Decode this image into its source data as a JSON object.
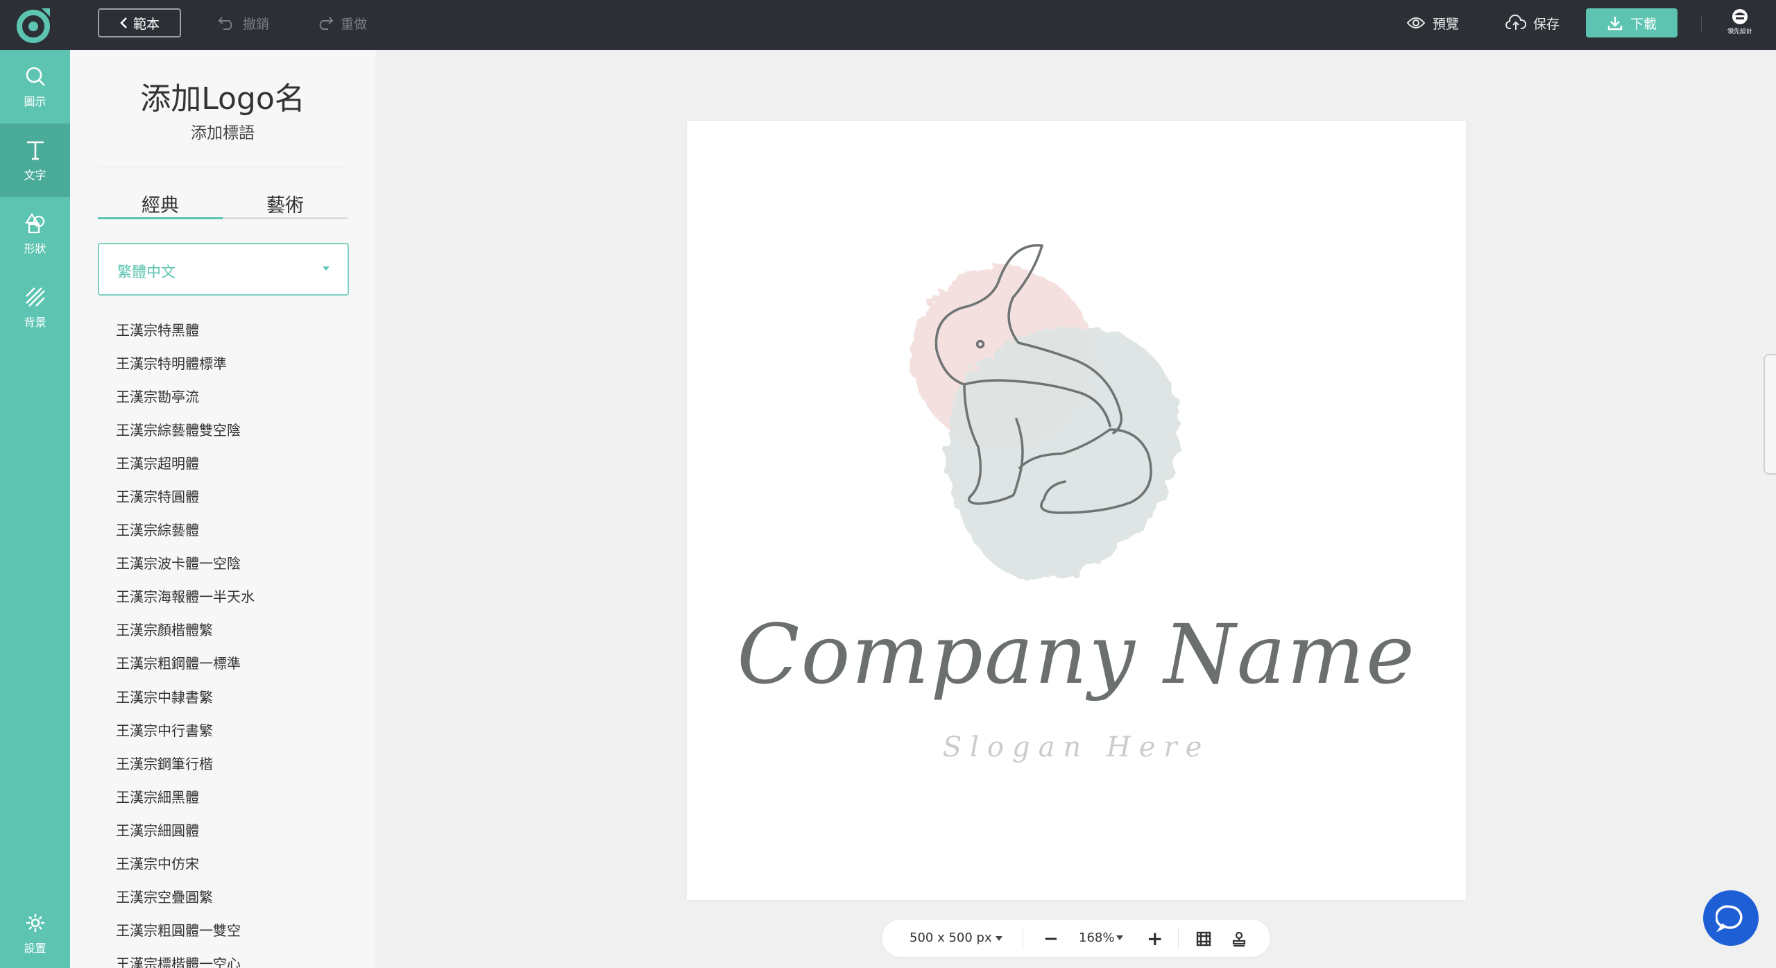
{
  "topbar": {
    "back_label": "範本",
    "undo_label": "撤銷",
    "redo_label": "重做",
    "preview_label": "預覽",
    "save_label": "保存",
    "download_label": "下載",
    "avatar_label": "領先設計"
  },
  "rail": {
    "items": [
      {
        "label": "圖示",
        "icon": "search-icon"
      },
      {
        "label": "文字",
        "icon": "text-icon"
      },
      {
        "label": "形狀",
        "icon": "shapes-icon"
      },
      {
        "label": "背景",
        "icon": "background-icon"
      }
    ],
    "settings_label": "設置"
  },
  "panel": {
    "title": "添加Logo名",
    "subtitle": "添加標語",
    "tabs": [
      "經典",
      "藝術"
    ],
    "language": "繁體中文",
    "fonts": [
      "王漢宗特黑體",
      "王漢宗特明體標準",
      "王漢宗勘亭流",
      "王漢宗綜藝體雙空陰",
      "王漢宗超明體",
      "王漢宗特圓體",
      "王漢宗綜藝體",
      "王漢宗波卡體一空陰",
      "王漢宗海報體一半天水",
      "王漢宗顏楷體繁",
      "王漢宗粗鋼體一標準",
      "王漢宗中隸書繁",
      "王漢宗中行書繁",
      "王漢宗鋼筆行楷",
      "王漢宗細黑體",
      "王漢宗細圓體",
      "王漢宗中仿宋",
      "王漢宗空疊圓繁",
      "王漢宗粗圓體一雙空",
      "王漢宗標楷體一空心"
    ]
  },
  "canvas": {
    "company_name": "Company Name",
    "slogan": "Slogan Here"
  },
  "bottom_bar": {
    "size": "500 x 500 px",
    "zoom": "168%"
  },
  "colors": {
    "accent": "#5cc4b1",
    "topbar": "#2c2f35",
    "chat": "#1f5fd6"
  }
}
